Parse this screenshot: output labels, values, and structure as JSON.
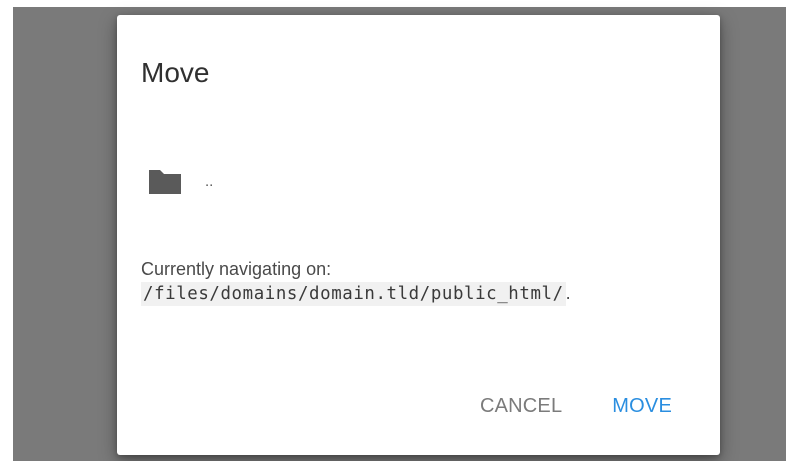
{
  "dialog": {
    "title": "Move",
    "items": [
      {
        "icon": "folder-icon",
        "name": ".."
      }
    ],
    "navigation": {
      "label": "Currently navigating on:",
      "path": "/files/domains/domain.tld/public_html/",
      "suffix": "."
    },
    "buttons": {
      "cancel_label": "CANCEL",
      "move_label": "MOVE"
    }
  },
  "colors": {
    "overlay": "#7a7a7a",
    "accent": "#2a8ee0",
    "muted_button": "#7b7b7b",
    "folder_icon": "#5a5a5a",
    "path_background": "#f1f1f1"
  }
}
